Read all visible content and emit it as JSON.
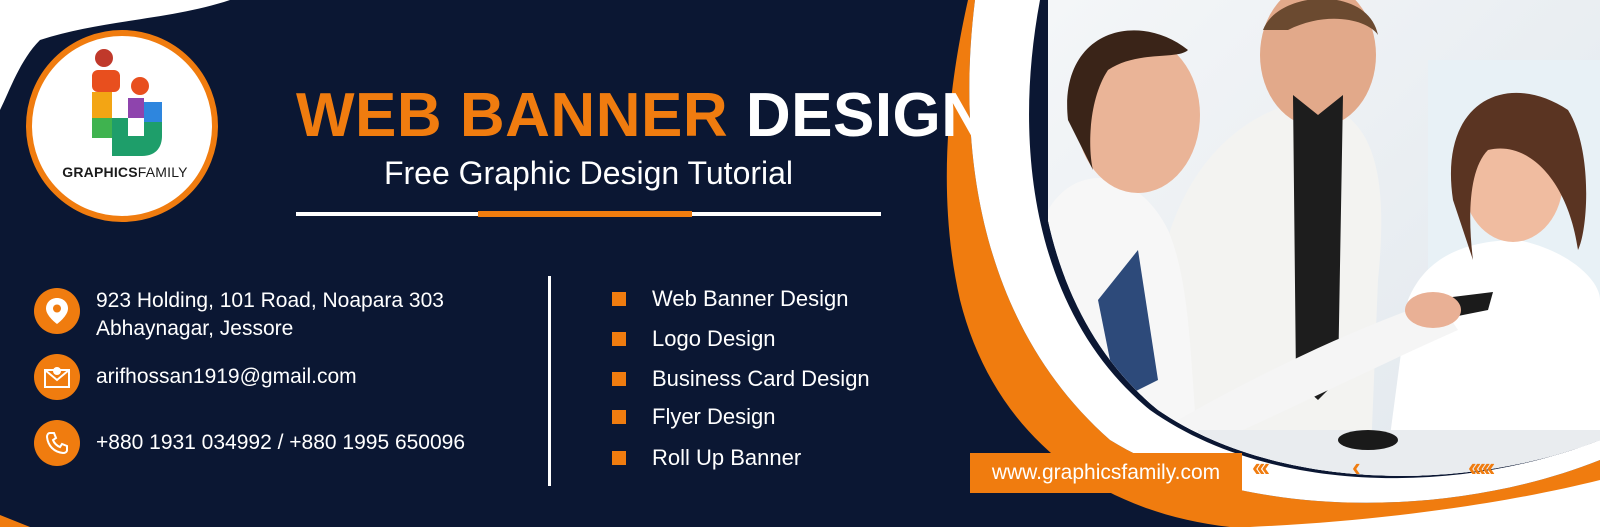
{
  "brand": {
    "name_bold": "GRAPHICS",
    "name_regular": "FAMILY"
  },
  "title": {
    "part_orange": "WEB BANNER",
    "part_white": "DESIGN"
  },
  "subtitle": "Free Graphic Design Tutorial",
  "contact": {
    "address_line1": "923 Holding, 101 Road, Noapara 303",
    "address_line2": "Abhaynagar, Jessore",
    "email": "arifhossan1919@gmail.com",
    "phone": "+880 1931 034992 / +880 1995 650096"
  },
  "services": [
    "Web Banner Design",
    "Logo Design",
    "Business Card Design",
    "Flyer Design",
    "Roll Up Banner"
  ],
  "website": "www.graphicsfamily.com",
  "colors": {
    "accent": "#f07c0f",
    "background": "#0b1733",
    "text": "#ffffff"
  },
  "icons": [
    "location-pin-icon",
    "email-icon",
    "phone-icon"
  ]
}
